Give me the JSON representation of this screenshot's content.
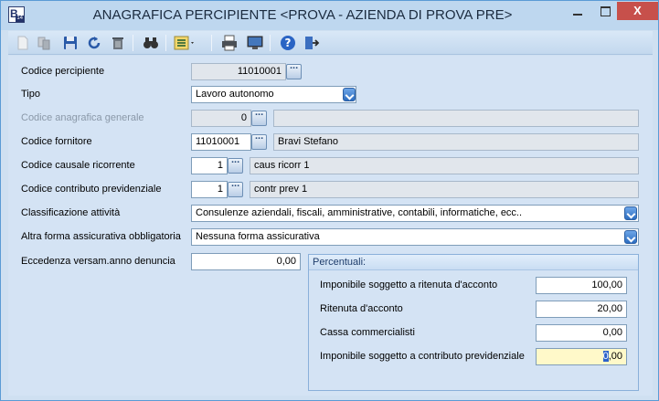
{
  "window": {
    "title": "ANAGRAFICA PERCIPIENTE <PROVA - AZIENDA DI PROVA PRE>",
    "app_icon_letter": "B",
    "app_icon_number": "14",
    "close_glyph": "X"
  },
  "toolbar": {
    "icons": [
      "new-icon",
      "copy-icon",
      "save-icon",
      "undo-icon",
      "delete-icon",
      "search-binoculars-icon",
      "list-view-icon",
      "print-icon",
      "monitor-icon",
      "help-icon",
      "exit-icon"
    ]
  },
  "form": {
    "codice_percipiente": {
      "label": "Codice percipiente",
      "value": "11010001"
    },
    "tipo": {
      "label": "Tipo",
      "value": "Lavoro autonomo"
    },
    "codice_anagrafica": {
      "label": "Codice anagrafica generale",
      "value": "0",
      "desc": ""
    },
    "codice_fornitore": {
      "label": "Codice fornitore",
      "value": "11010001",
      "desc": "Bravi Stefano"
    },
    "codice_causale": {
      "label": "Codice  causale ricorrente",
      "value": "1",
      "desc": "caus ricorr 1"
    },
    "codice_contributo": {
      "label": "Codice contributo previdenziale",
      "value": "1",
      "desc": "contr prev 1"
    },
    "classificazione": {
      "label": "Classificazione attività",
      "value": "Consulenze aziendali, fiscali, amministrative, contabili, informatiche, ecc.."
    },
    "altra_forma": {
      "label": "Altra forma assicurativa obbligatoria",
      "value": "Nessuna forma assicurativa"
    },
    "eccedenza": {
      "label": "Eccedenza versam.anno denuncia",
      "value": "0,00"
    }
  },
  "percentuali": {
    "title": "Percentuali:",
    "imponibile_ritenuta": {
      "label": "Imponibile soggetto a ritenuta  d'acconto",
      "value": "100,00"
    },
    "ritenuta": {
      "label": "Ritenuta d'acconto",
      "value": "20,00"
    },
    "cassa": {
      "label": "Cassa commercialisti",
      "value": "0,00"
    },
    "imponibile_contributo": {
      "label": "Imponibile soggetto a contributo previdenziale",
      "value_selected": "0",
      "value_rest": ",00"
    }
  }
}
